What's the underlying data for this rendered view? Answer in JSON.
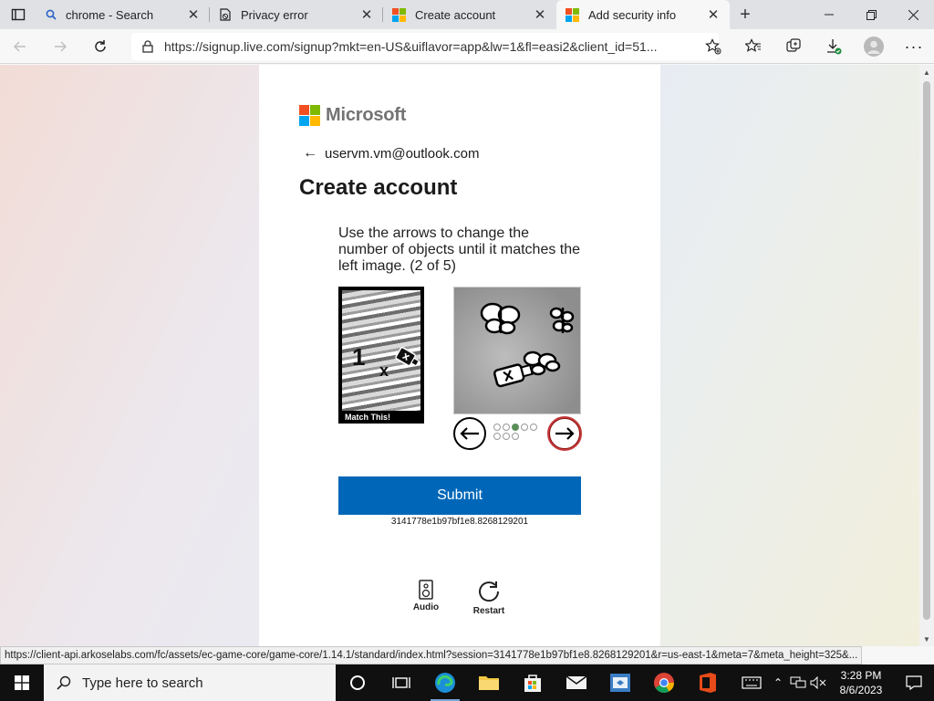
{
  "browser": {
    "tabs": [
      {
        "label": "chrome - Search",
        "icon": "search-icon"
      },
      {
        "label": "Privacy error",
        "icon": "privacy-error-icon"
      },
      {
        "label": "Create account",
        "icon": "microsoft-logo-icon"
      },
      {
        "label": "Add security info",
        "icon": "microsoft-logo-icon",
        "active": true
      }
    ],
    "address_url": "https://signup.live.com/signup?mkt=en-US&uiflavor=app&lw=1&fl=easi2&client_id=51...",
    "status_url": "https://client-api.arkoselabs.com/fc/assets/ec-game-core/game-core/1.14.1/standard/index.html?session=3141778e1b97bf1e8.8268129201&r=us-east-1&meta=7&meta_height=325&..."
  },
  "page": {
    "brand": "Microsoft",
    "identity": "uservm.vm@outlook.com",
    "title": "Create account",
    "challenge": {
      "instructions": "Use the arrows to change the number of objects until it matches the left image. (2 of 5)",
      "reference_label": "Match This!",
      "reference_numeral": "1",
      "reference_symbol": "x",
      "dots_total": 8,
      "dots_active_index": 2
    },
    "submit_label": "Submit",
    "session_id": "3141778e1b97bf1e8.8268129201",
    "audio_label": "Audio",
    "restart_label": "Restart"
  },
  "taskbar": {
    "search_placeholder": "Type here to search",
    "time": "3:28 PM",
    "date": "8/6/2023"
  },
  "colors": {
    "submit_bg": "#0067b8",
    "ms_red": "#f25022",
    "ms_green": "#7fba00",
    "ms_blue": "#00a4ef",
    "ms_yellow": "#ffb900"
  }
}
